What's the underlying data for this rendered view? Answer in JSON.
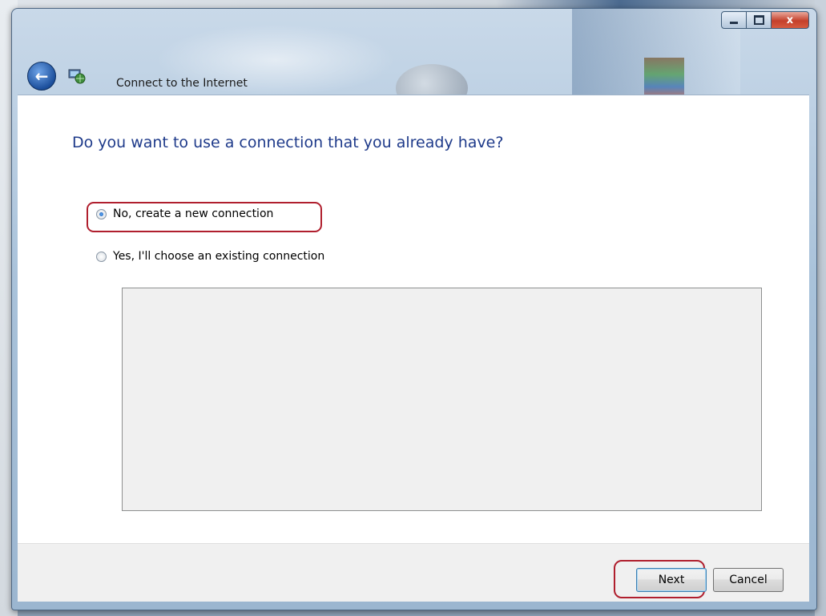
{
  "window": {
    "title": "Connect to the Internet",
    "caption_buttons": {
      "minimize_icon": "minimize-icon",
      "maximize_icon": "maximize-icon",
      "close_icon": "close-icon",
      "close_glyph": "x"
    }
  },
  "header": {
    "back_icon": "back-arrow-icon",
    "back_glyph": "←",
    "network_icon": "network-icon"
  },
  "content": {
    "question": "Do you want to use a connection that you already have?",
    "options": [
      {
        "label": "No, create a new connection",
        "selected": true
      },
      {
        "label": "Yes, I'll choose an existing connection",
        "selected": false
      }
    ],
    "connection_list": []
  },
  "footer": {
    "next_label": "Next",
    "cancel_label": "Cancel"
  },
  "colors": {
    "question_text": "#1e3a8a",
    "highlight": "#b01f2e",
    "footer_bg": "#f0f0f0"
  }
}
